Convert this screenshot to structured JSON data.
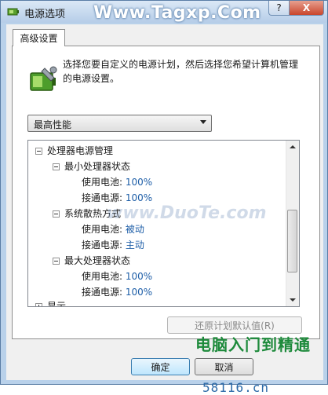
{
  "window": {
    "title": "电源选项",
    "watermark": "Www.Tagxp.Com",
    "help_label": "?",
    "close_label": "X"
  },
  "tabs": [
    {
      "label": "高级设置"
    }
  ],
  "description": "选择您要自定义的电源计划，然后选择您希望计算机管理的电源设置。",
  "plan_select": {
    "value": "最高性能"
  },
  "tree": {
    "items": [
      {
        "label": "处理器电源管理",
        "expanded": true
      },
      {
        "label": "最小处理器状态",
        "expanded": true
      },
      {
        "label": "使用电池:",
        "value": "100%"
      },
      {
        "label": "接通电源:",
        "value": "100%"
      },
      {
        "label": "系统散热方式",
        "expanded": true
      },
      {
        "label": "使用电池:",
        "value": "被动"
      },
      {
        "label": "接通电源:",
        "value": "主动"
      },
      {
        "label": "最大处理器状态",
        "expanded": true
      },
      {
        "label": "使用电池:",
        "value": "100%"
      },
      {
        "label": "接通电源:",
        "value": "100%"
      },
      {
        "label": "显示",
        "expanded": false
      }
    ]
  },
  "buttons": {
    "restore": "还原计划默认值(R)",
    "ok": "确定",
    "cancel": "取消"
  },
  "watermarks": {
    "center": "www.DuoTe.com",
    "brand_cn": "电脑入门到精通",
    "site": "58116.cn"
  },
  "colors": {
    "link": "#1f5fa8",
    "title_bg": "#b9d1ea",
    "close_red": "#c9462c"
  }
}
